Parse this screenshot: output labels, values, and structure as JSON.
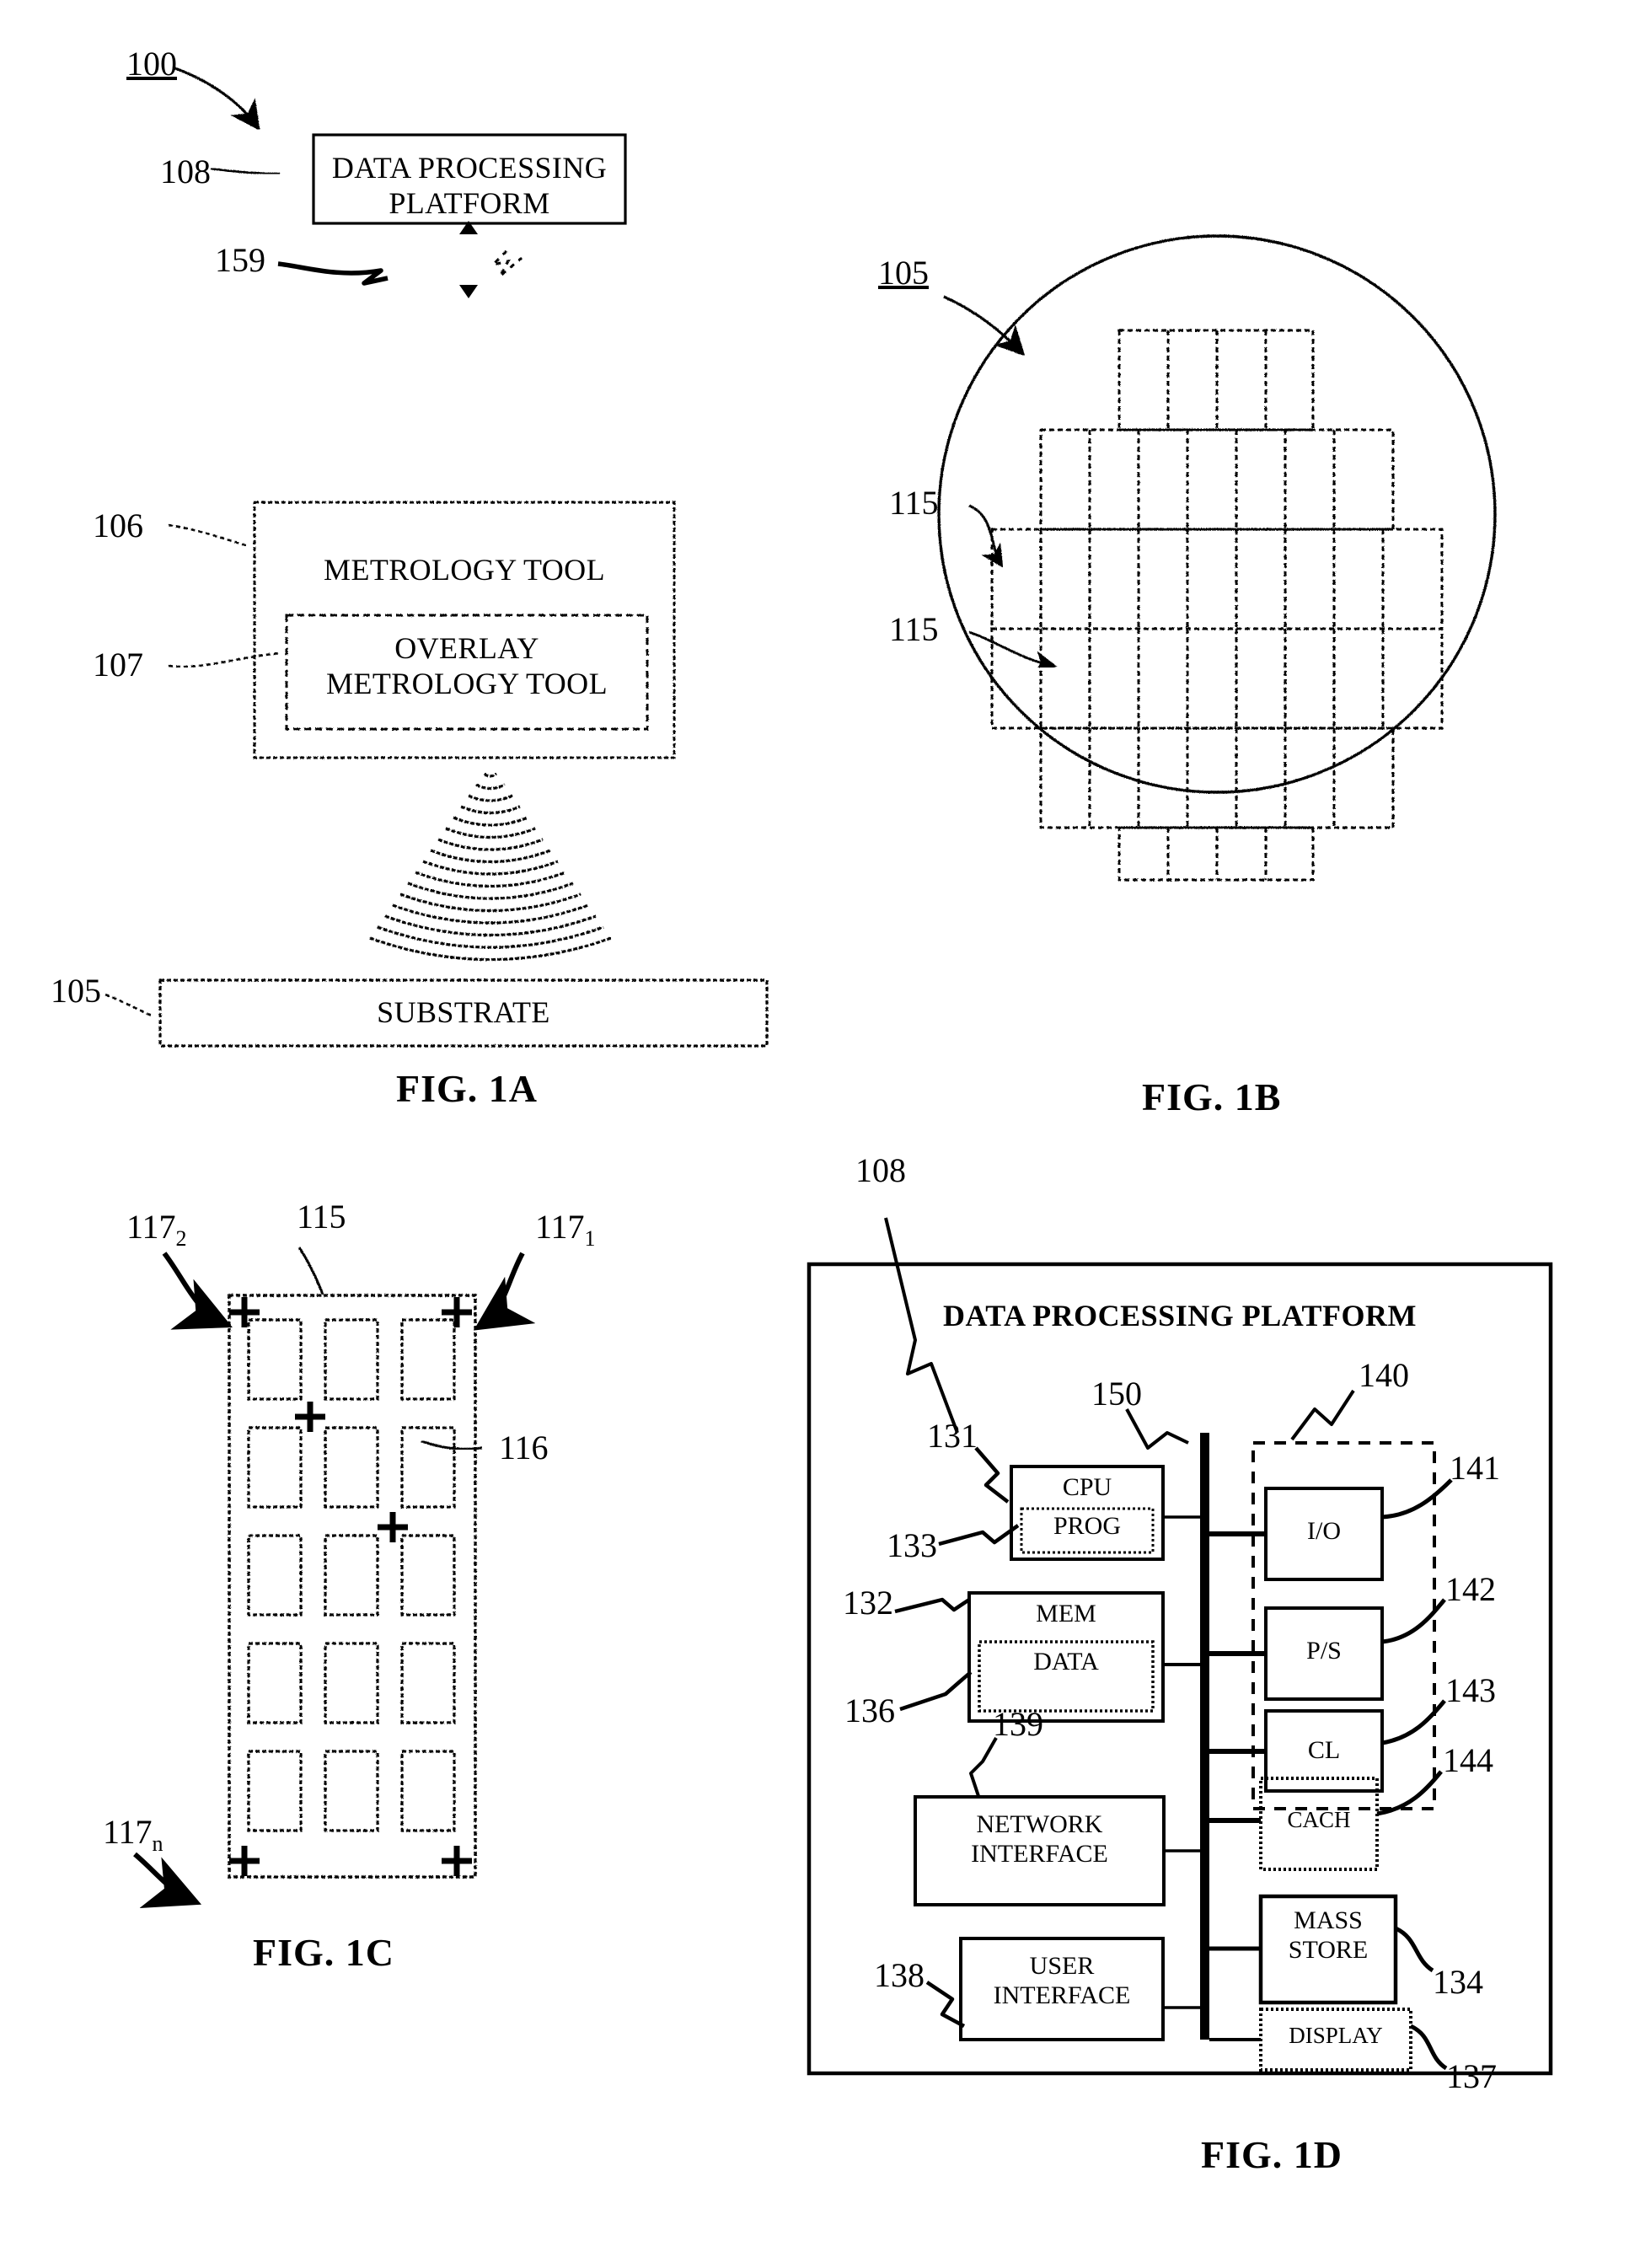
{
  "figure": {
    "sheet_ref": "100",
    "captions": {
      "fig1a": "FIG. 1A",
      "fig1b": "FIG. 1B",
      "fig1c": "FIG. 1C",
      "fig1d": "FIG. 1D"
    }
  },
  "fig1a": {
    "title_ref": "100",
    "blocks": [
      {
        "id": "dpp",
        "label": "DATA PROCESSING\nPLATFORM",
        "ref": "108"
      },
      {
        "id": "met",
        "label": "METROLOGY TOOL",
        "ref": "106"
      },
      {
        "id": "ovl",
        "label": "OVERLAY\nMETROLOGY TOOL",
        "ref": "107"
      },
      {
        "id": "sub",
        "label": "SUBSTRATE",
        "ref": "105"
      }
    ],
    "link_ref": "159",
    "labels": {
      "dpp_line1": "DATA PROCESSING",
      "dpp_line2": "PLATFORM",
      "metrology": "METROLOGY TOOL",
      "overlay_line1": "OVERLAY",
      "overlay_line2": "METROLOGY TOOL",
      "substrate": "SUBSTRATE"
    },
    "refs": {
      "r108": "108",
      "r159": "159",
      "r106": "106",
      "r107": "107",
      "r105": "105"
    }
  },
  "fig1b": {
    "wafer_ref": "105",
    "die_ref_upper": "115",
    "die_ref_lower": "115",
    "grid": {
      "rows": 5,
      "cols": 7
    }
  },
  "fig1c": {
    "die_ref": "115",
    "cell_ref": "116",
    "mark_ref_1": "117",
    "mark_sub_1": "1",
    "mark_ref_2": "117",
    "mark_sub_2": "2",
    "mark_ref_n": "117",
    "mark_sub_n": "n",
    "grid": {
      "rows": 5,
      "cols": 3
    }
  },
  "fig1d": {
    "platform_ref": "108",
    "title": "DATA PROCESSING PLATFORM",
    "bus_ref": "150",
    "support_group_ref": "140",
    "blocks": [
      {
        "id": "cpu",
        "label": "CPU",
        "ref": "131"
      },
      {
        "id": "prog",
        "label": "PROG",
        "ref": "133"
      },
      {
        "id": "mem",
        "label": "MEM",
        "ref": "132"
      },
      {
        "id": "data",
        "label": "DATA",
        "ref": "136"
      },
      {
        "id": "netif",
        "label": "NETWORK\nINTERFACE",
        "ref": "139"
      },
      {
        "id": "userif",
        "label": "USER\nINTERFACE",
        "ref": "138"
      },
      {
        "id": "io",
        "label": "I/O",
        "ref": "141"
      },
      {
        "id": "ps",
        "label": "P/S",
        "ref": "142"
      },
      {
        "id": "cl",
        "label": "CL",
        "ref": "143"
      },
      {
        "id": "cach",
        "label": "CACH",
        "ref": "144"
      },
      {
        "id": "mass",
        "label": "MASS\nSTORE",
        "ref": "134"
      },
      {
        "id": "display",
        "label": "DISPLAY",
        "ref": "137"
      }
    ],
    "labels": {
      "cpu": "CPU",
      "prog": "PROG",
      "mem": "MEM",
      "data": "DATA",
      "net_l1": "NETWORK",
      "net_l2": "INTERFACE",
      "user_l1": "USER",
      "user_l2": "INTERFACE",
      "io": "I/O",
      "ps": "P/S",
      "cl": "CL",
      "cach": "CACH",
      "mass_l1": "MASS",
      "mass_l2": "STORE",
      "display": "DISPLAY"
    },
    "refs": {
      "r108": "108",
      "r150": "150",
      "r140": "140",
      "r131": "131",
      "r133": "133",
      "r132": "132",
      "r136": "136",
      "r139": "139",
      "r138": "138",
      "r141": "141",
      "r142": "142",
      "r143": "143",
      "r144": "144",
      "r134": "134",
      "r137": "137"
    }
  },
  "colors": {
    "ink": "#000000",
    "paper": "#ffffff"
  }
}
